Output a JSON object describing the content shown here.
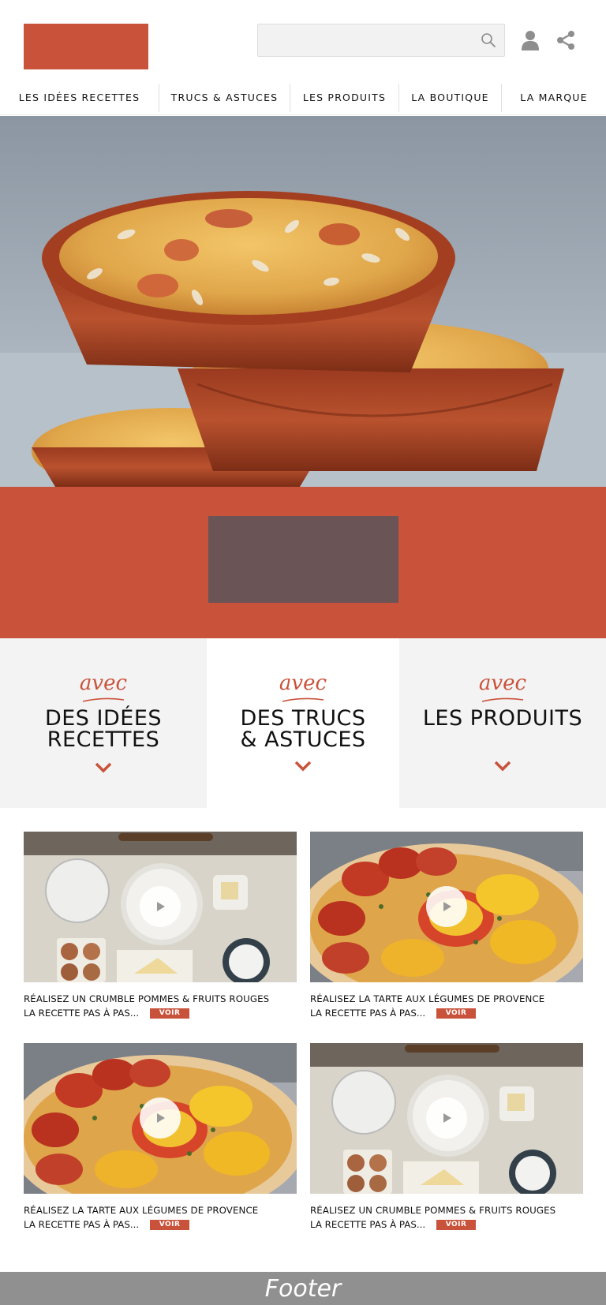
{
  "header": {
    "search_placeholder": "",
    "icons": {
      "search": "search-icon",
      "user": "user-icon",
      "share": "share-icon"
    }
  },
  "nav": {
    "items": [
      {
        "label": "LES IDÉES RECETTES"
      },
      {
        "label": "TRUCS & ASTUCES"
      },
      {
        "label": "LES PRODUITS"
      },
      {
        "label": "LA BOUTIQUE"
      },
      {
        "label": "LA MARQUE"
      }
    ]
  },
  "categories": [
    {
      "avec": "avec",
      "title": "DES IDÉES\nRECETTES"
    },
    {
      "avec": "avec",
      "title": "DES TRUCS\n& ASTUCES"
    },
    {
      "avec": "avec",
      "title": "LES PRODUITS"
    }
  ],
  "cards": [
    {
      "title": "RÉALISEZ UN CRUMBLE POMMES & FRUITS ROUGES",
      "sub": "LA RECETTE PAS À PAS...",
      "button": "VOIR",
      "image": "crumble-ingredients"
    },
    {
      "title": "RÉALISEZ LA TARTE AUX LÉGUMES DE PROVENCE",
      "sub": "LA RECETTE PAS À PAS...",
      "button": "VOIR",
      "image": "vegetable-tart"
    },
    {
      "title": "RÉALISEZ LA TARTE AUX LÉGUMES DE PROVENCE",
      "sub": "LA RECETTE PAS À PAS...",
      "button": "VOIR",
      "image": "vegetable-tart"
    },
    {
      "title": "RÉALISEZ UN CRUMBLE POMMES & FRUITS ROUGES",
      "sub": "LA RECETTE PAS À PAS...",
      "button": "VOIR",
      "image": "crumble-ingredients"
    }
  ],
  "footer": {
    "label": "Footer"
  },
  "colors": {
    "accent": "#c9523b",
    "block": "#6b5456",
    "footer": "#909090",
    "panel": "#f3f3f3"
  }
}
